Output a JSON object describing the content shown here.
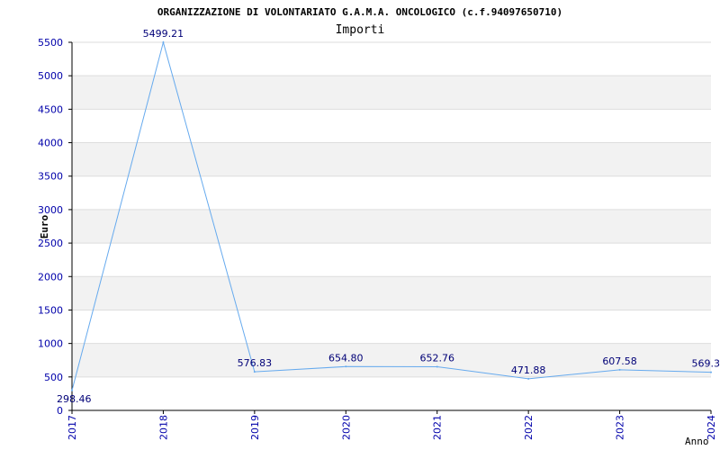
{
  "chart_data": {
    "type": "line",
    "title": "ORGANIZZAZIONE DI VOLONTARIATO G.A.M.A. ONCOLOGICO (c.f.94097650710)",
    "subtitle": "Importi",
    "xlabel": "Anno",
    "ylabel": "Euro",
    "x": [
      "2017",
      "2018",
      "2019",
      "2020",
      "2021",
      "2022",
      "2023",
      "2024"
    ],
    "series": [
      {
        "values": [
          298.46,
          5499.21,
          576.83,
          654.8,
          652.76,
          471.88,
          607.58,
          569.3
        ],
        "labels": [
          "298.46",
          "5499.21",
          "576.83",
          "654.80",
          "652.76",
          "471.88",
          "607.58",
          "569.3"
        ]
      }
    ],
    "ylim": [
      0,
      5500
    ],
    "yticks": [
      0,
      500,
      1000,
      1500,
      2000,
      2500,
      3000,
      3500,
      4000,
      4500,
      5000,
      5500
    ],
    "grid": true,
    "colors": {
      "line": "#66aaee",
      "band": "#f2f2f2",
      "grid": "#dddddd",
      "axis": "#000000",
      "tick_label": "#0000aa",
      "data_label": "#000077",
      "title": "#000000",
      "subtitle": "#333333"
    }
  }
}
